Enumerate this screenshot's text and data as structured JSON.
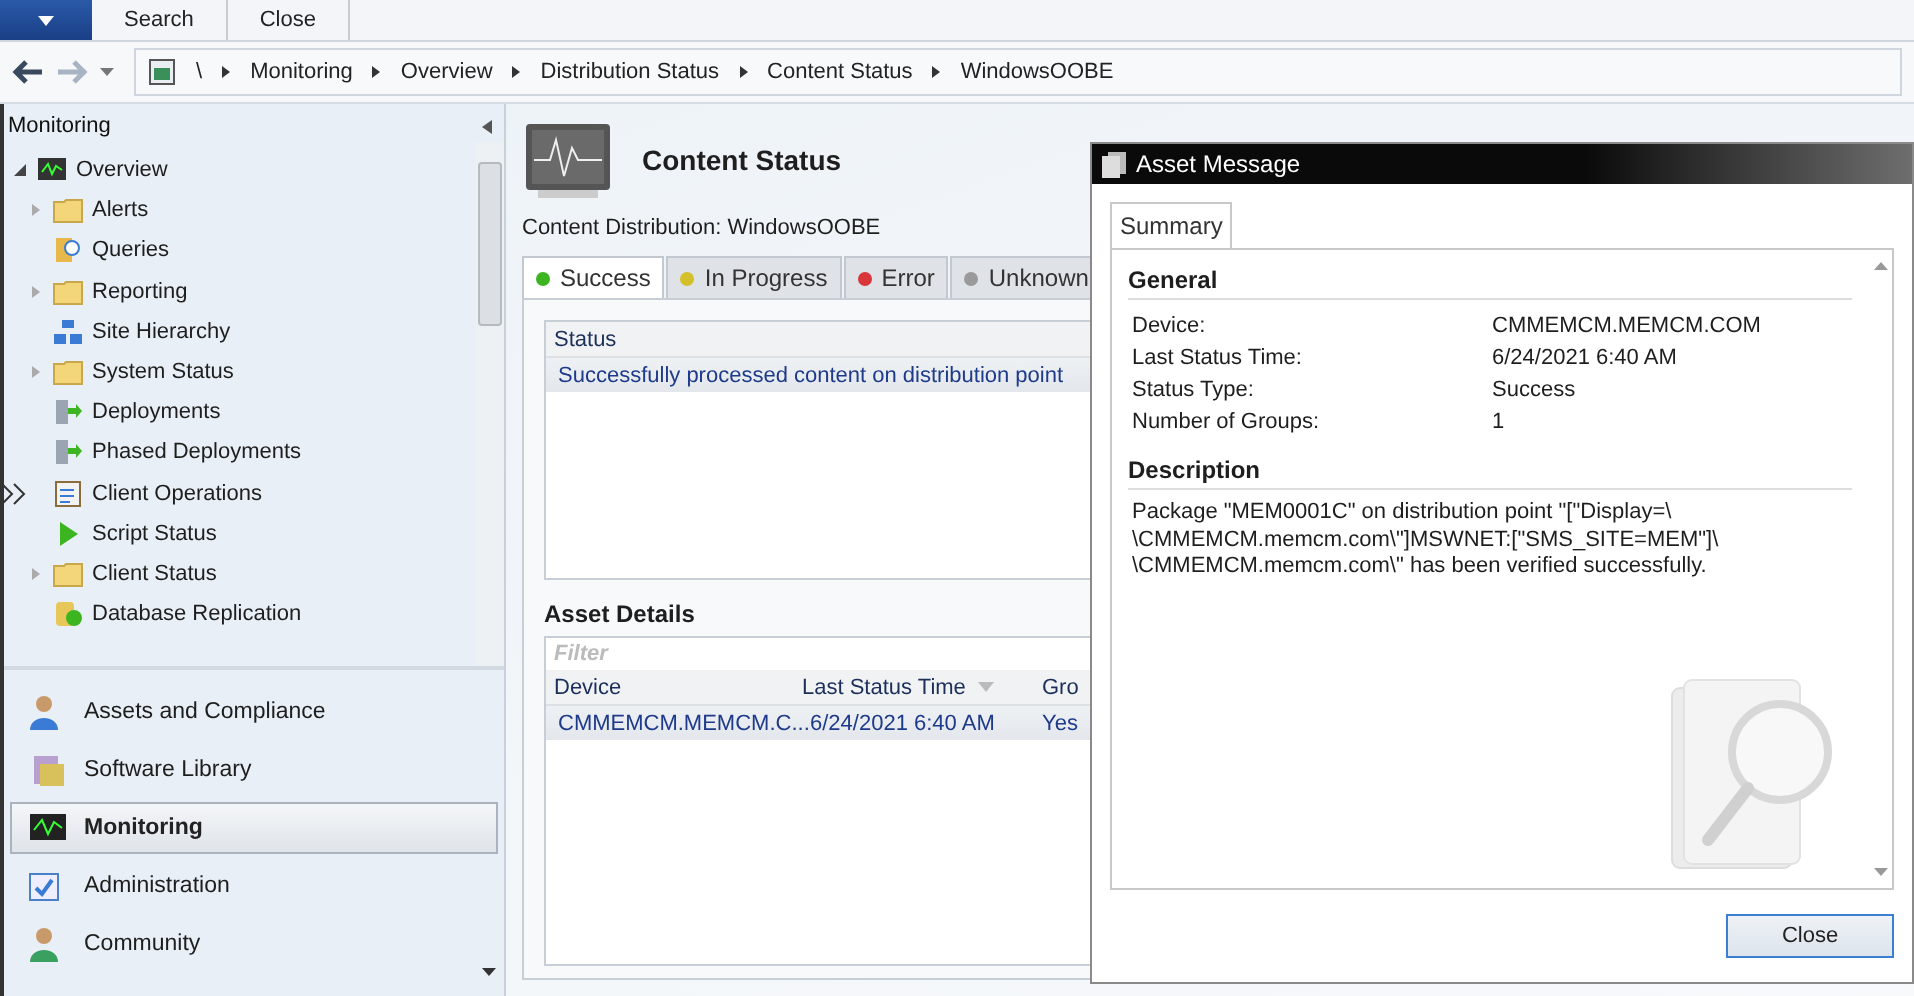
{
  "ribbon": {
    "tabs": [
      {
        "label": "Search"
      },
      {
        "label": "Close"
      }
    ]
  },
  "address_bar": {
    "root": "\\",
    "crumbs": [
      "Monitoring",
      "Overview",
      "Distribution Status",
      "Content Status",
      "WindowsOOBE"
    ]
  },
  "navigation": {
    "title": "Monitoring",
    "tree": [
      {
        "label": "Overview",
        "kind": "monitor",
        "expanded": true,
        "children": [
          {
            "label": "Alerts",
            "kind": "folder",
            "expanded": false
          },
          {
            "label": "Queries",
            "kind": "query"
          },
          {
            "label": "Reporting",
            "kind": "folder",
            "expanded": false
          },
          {
            "label": "Site Hierarchy",
            "kind": "hierarchy"
          },
          {
            "label": "System Status",
            "kind": "folder",
            "expanded": false
          },
          {
            "label": "Deployments",
            "kind": "deploy"
          },
          {
            "label": "Phased Deployments",
            "kind": "deploy"
          },
          {
            "label": "Client Operations",
            "kind": "clipboard",
            "pointer": true
          },
          {
            "label": "Script Status",
            "kind": "play"
          },
          {
            "label": "Client Status",
            "kind": "folder",
            "expanded": false
          },
          {
            "label": "Database Replication",
            "kind": "database"
          }
        ]
      }
    ],
    "workspaces": [
      {
        "label": "Assets and Compliance",
        "kind": "user",
        "selected": false
      },
      {
        "label": "Software Library",
        "kind": "library",
        "selected": false
      },
      {
        "label": "Monitoring",
        "kind": "monitor",
        "selected": true
      },
      {
        "label": "Administration",
        "kind": "admin",
        "selected": false
      },
      {
        "label": "Community",
        "kind": "community",
        "selected": false
      }
    ]
  },
  "content": {
    "title": "Content Status",
    "subtitle": "Content Distribution: WindowsOOBE",
    "tabs": [
      {
        "label": "Success",
        "color": "#3cb521",
        "selected": true
      },
      {
        "label": "In Progress",
        "color": "#d4c02a",
        "selected": false
      },
      {
        "label": "Error",
        "color": "#d8363a",
        "selected": false
      },
      {
        "label": "Unknown",
        "color": "#9a9a9a",
        "selected": false
      }
    ],
    "status_table": {
      "columns": [
        "Status"
      ],
      "rows": [
        {
          "cells": [
            "Successfully processed content on distribution point"
          ],
          "selected": true
        }
      ]
    },
    "asset_details": {
      "title": "Asset Details",
      "filter_placeholder": "Filter",
      "columns": [
        {
          "label": "Device",
          "sorted": false
        },
        {
          "label": "Last Status Time",
          "sorted": true
        },
        {
          "label": "Gro",
          "sorted": false
        }
      ],
      "rows": [
        {
          "cells": [
            "CMMEMCM.MEMCM.C...",
            "6/24/2021 6:40 AM",
            "Yes"
          ],
          "selected": true
        }
      ]
    }
  },
  "dialog": {
    "title": "Asset Message",
    "tab": "Summary",
    "general": {
      "heading": "General",
      "fields": [
        {
          "label": "Device:",
          "value": "CMMEMCM.MEMCM.COM"
        },
        {
          "label": "Last Status Time:",
          "value": "6/24/2021 6:40 AM"
        },
        {
          "label": "Status Type:",
          "value": "Success"
        },
        {
          "label": "Number of Groups:",
          "value": "1"
        }
      ]
    },
    "description": {
      "heading": "Description",
      "lines": [
        "Package \"MEM0001C\" on distribution point \"[\"Display=\\",
        "\\CMMEMCM.memcm.com\\\"]MSWNET:[\"SMS_SITE=MEM\"]\\",
        "\\CMMEMCM.memcm.com\\\" has been verified successfully."
      ]
    },
    "button": "Close"
  }
}
